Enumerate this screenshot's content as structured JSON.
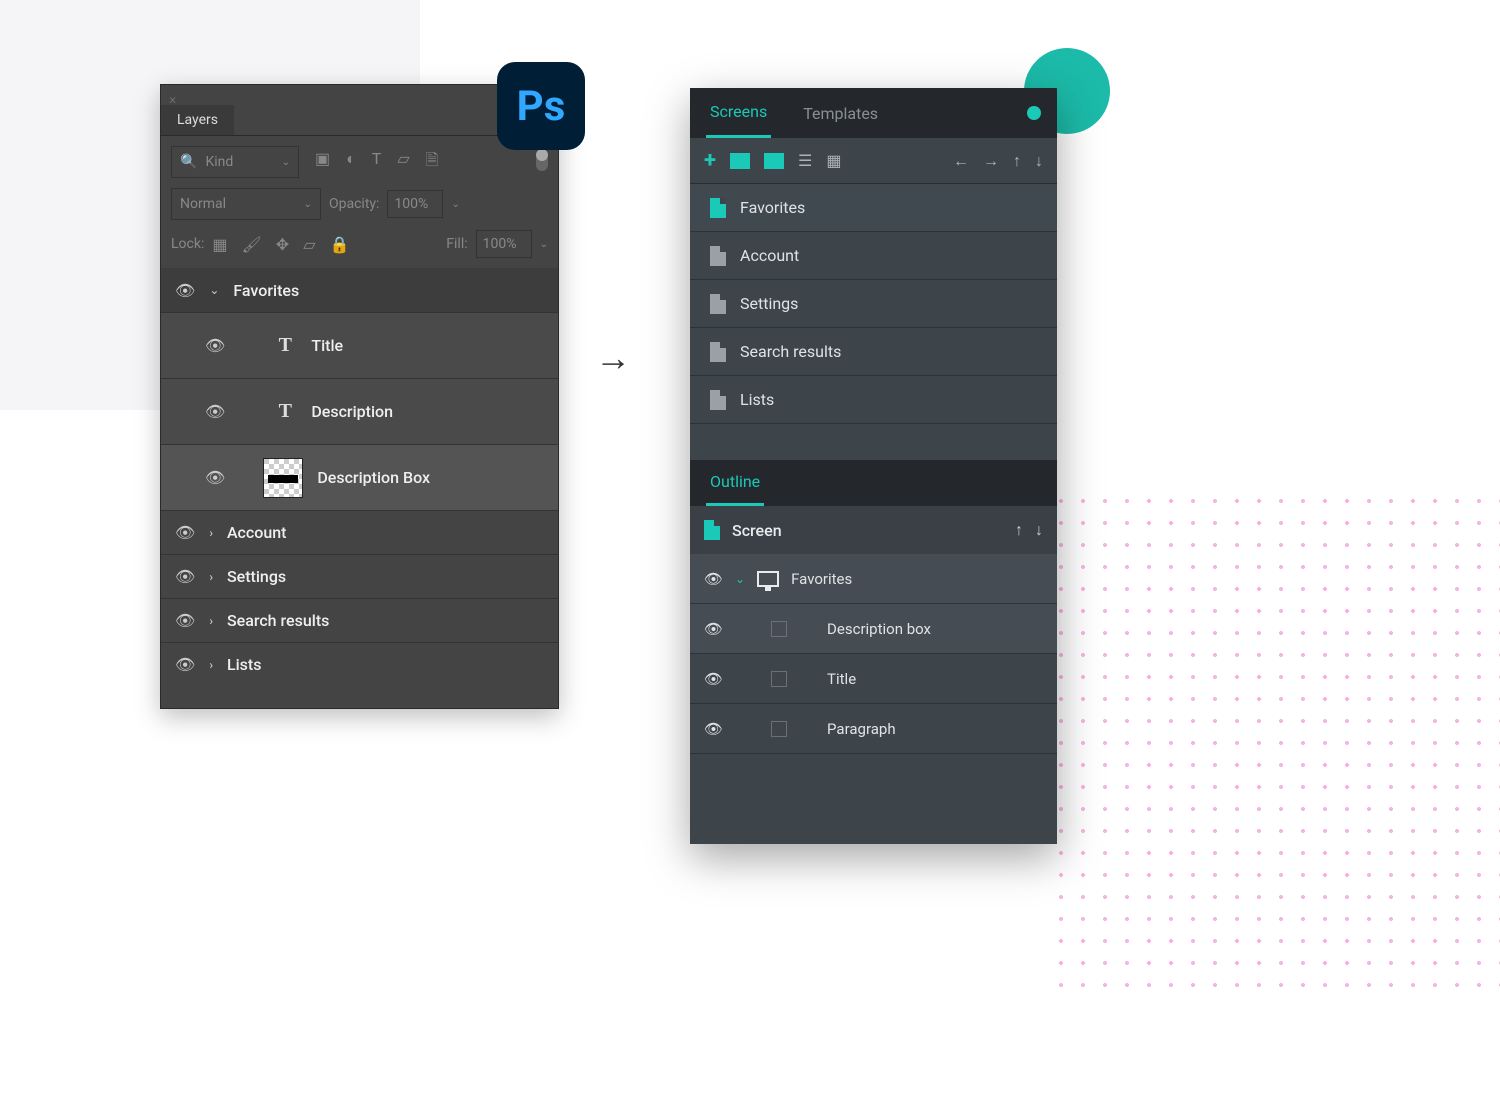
{
  "ps": {
    "badge": "Ps",
    "tab": "Layers",
    "kind": "Kind",
    "blend": "Normal",
    "opacity_label": "Opacity:",
    "opacity": "100%",
    "lock_label": "Lock:",
    "fill_label": "Fill:",
    "fill": "100%",
    "favorites": "Favorites",
    "layers": {
      "title": "Title",
      "description": "Description",
      "description_box": "Description Box"
    },
    "groups": [
      "Account",
      "Settings",
      "Search results",
      "Lists"
    ]
  },
  "rp": {
    "tabs": {
      "screens": "Screens",
      "templates": "Templates"
    },
    "screens": [
      "Favorites",
      "Account",
      "Settings",
      "Search results",
      "Lists"
    ],
    "outline_label": "Outline",
    "screen_header": "Screen",
    "outline": {
      "root": "Favorites",
      "items": [
        "Description box",
        "Title",
        "Paragraph"
      ]
    }
  }
}
